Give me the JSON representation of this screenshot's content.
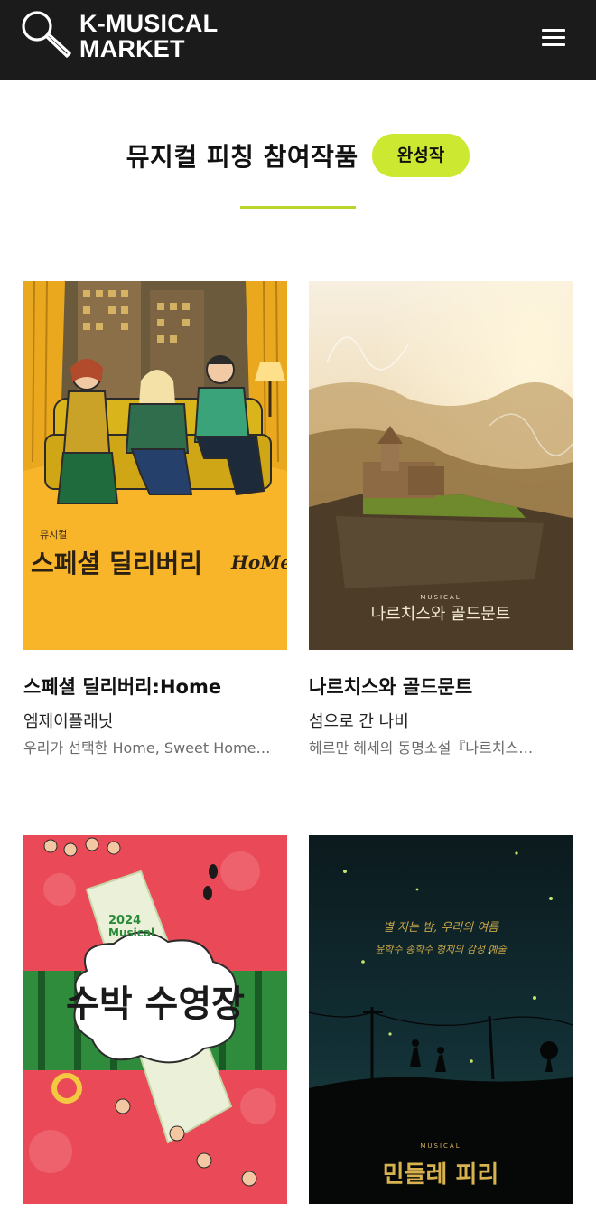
{
  "header": {
    "logo_line1": "K-MUSICAL",
    "logo_line2": "MARKET",
    "menu_icon": "hamburger-menu-icon",
    "logo_icon": "microphone-icon"
  },
  "section": {
    "title": "뮤지컬 피칭 참여작품",
    "badge": "완성작"
  },
  "colors": {
    "header_bg": "#1b1b1b",
    "accent": "#cde830"
  },
  "works": [
    {
      "title": "스페셜 딜리버리:Home",
      "company": "엠제이플래닛",
      "description": "우리가 선택한 Home, Sweet Home…",
      "poster_text": "스페셜 딜리버리",
      "poster_text_suffix": "HoMe",
      "poster_small": "뮤지컬"
    },
    {
      "title": "나르치스와 골드문트",
      "company": "섬으로 간 나비",
      "description": "헤르만 헤세의 동명소설『나르치스…",
      "poster_text": "나르치스와 골드문트",
      "poster_small": "MUSICAL"
    },
    {
      "title": "",
      "company": "",
      "description": "",
      "poster_text": "수박 수영장",
      "poster_year": "2024",
      "poster_small": "Musical"
    },
    {
      "title": "",
      "company": "",
      "description": "",
      "poster_text": "민들레 피리",
      "poster_small": "MUSICAL",
      "poster_line1": "별 지는 밤, 우리의 여름",
      "poster_line2": "윤학수 송학수 형제의 감성 예술"
    }
  ]
}
